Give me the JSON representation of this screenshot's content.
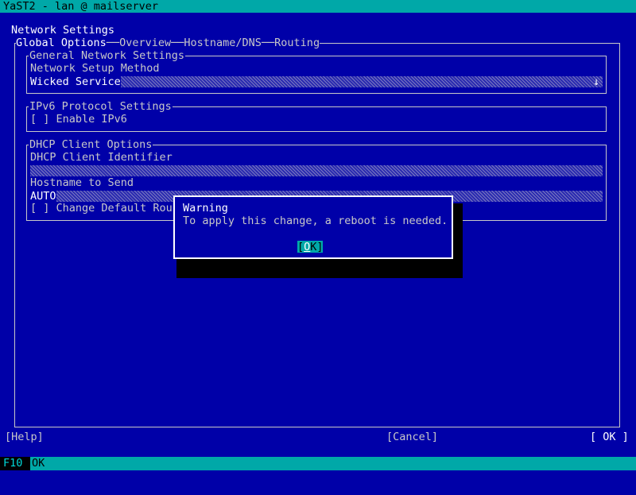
{
  "window": {
    "title": "YaST2 - lan @ mailserver"
  },
  "page_title": "Network Settings",
  "tabs": [
    {
      "label": "Global Options",
      "active": true
    },
    {
      "label": "Overview",
      "active": false
    },
    {
      "label": "Hostname/DNS",
      "active": false
    },
    {
      "label": "Routing",
      "active": false
    }
  ],
  "general": {
    "legend": "General Network Settings",
    "method_label": "Network Setup Method",
    "method_value": "Wicked Service",
    "dropdown_arrow": "↓"
  },
  "ipv6": {
    "legend": "IPv6 Protocol Settings",
    "enable_checkbox": "[ ] Enable IPv6"
  },
  "dhcp": {
    "legend": "DHCP Client Options",
    "client_id_label": "DHCP Client Identifier",
    "client_id_value": "",
    "hostname_label": "Hostname to Send",
    "hostname_value": "AUTO",
    "default_route_checkbox": "[ ] Change Default Rou"
  },
  "dialog": {
    "title": "Warning",
    "message": "To apply this change, a reboot is needed.",
    "ok_label_left": "[",
    "ok_label_hotkey": "O",
    "ok_label_rest": "K]"
  },
  "bottom_buttons": {
    "help": "[Help]",
    "cancel": "[Cancel]",
    "ok": "[ OK ]"
  },
  "statusbar": {
    "fkey": "F10",
    "fkey_desc": "OK"
  },
  "colors": {
    "background": "#0000a8",
    "accent": "#00a8a8",
    "highlight": "#ffff54"
  }
}
